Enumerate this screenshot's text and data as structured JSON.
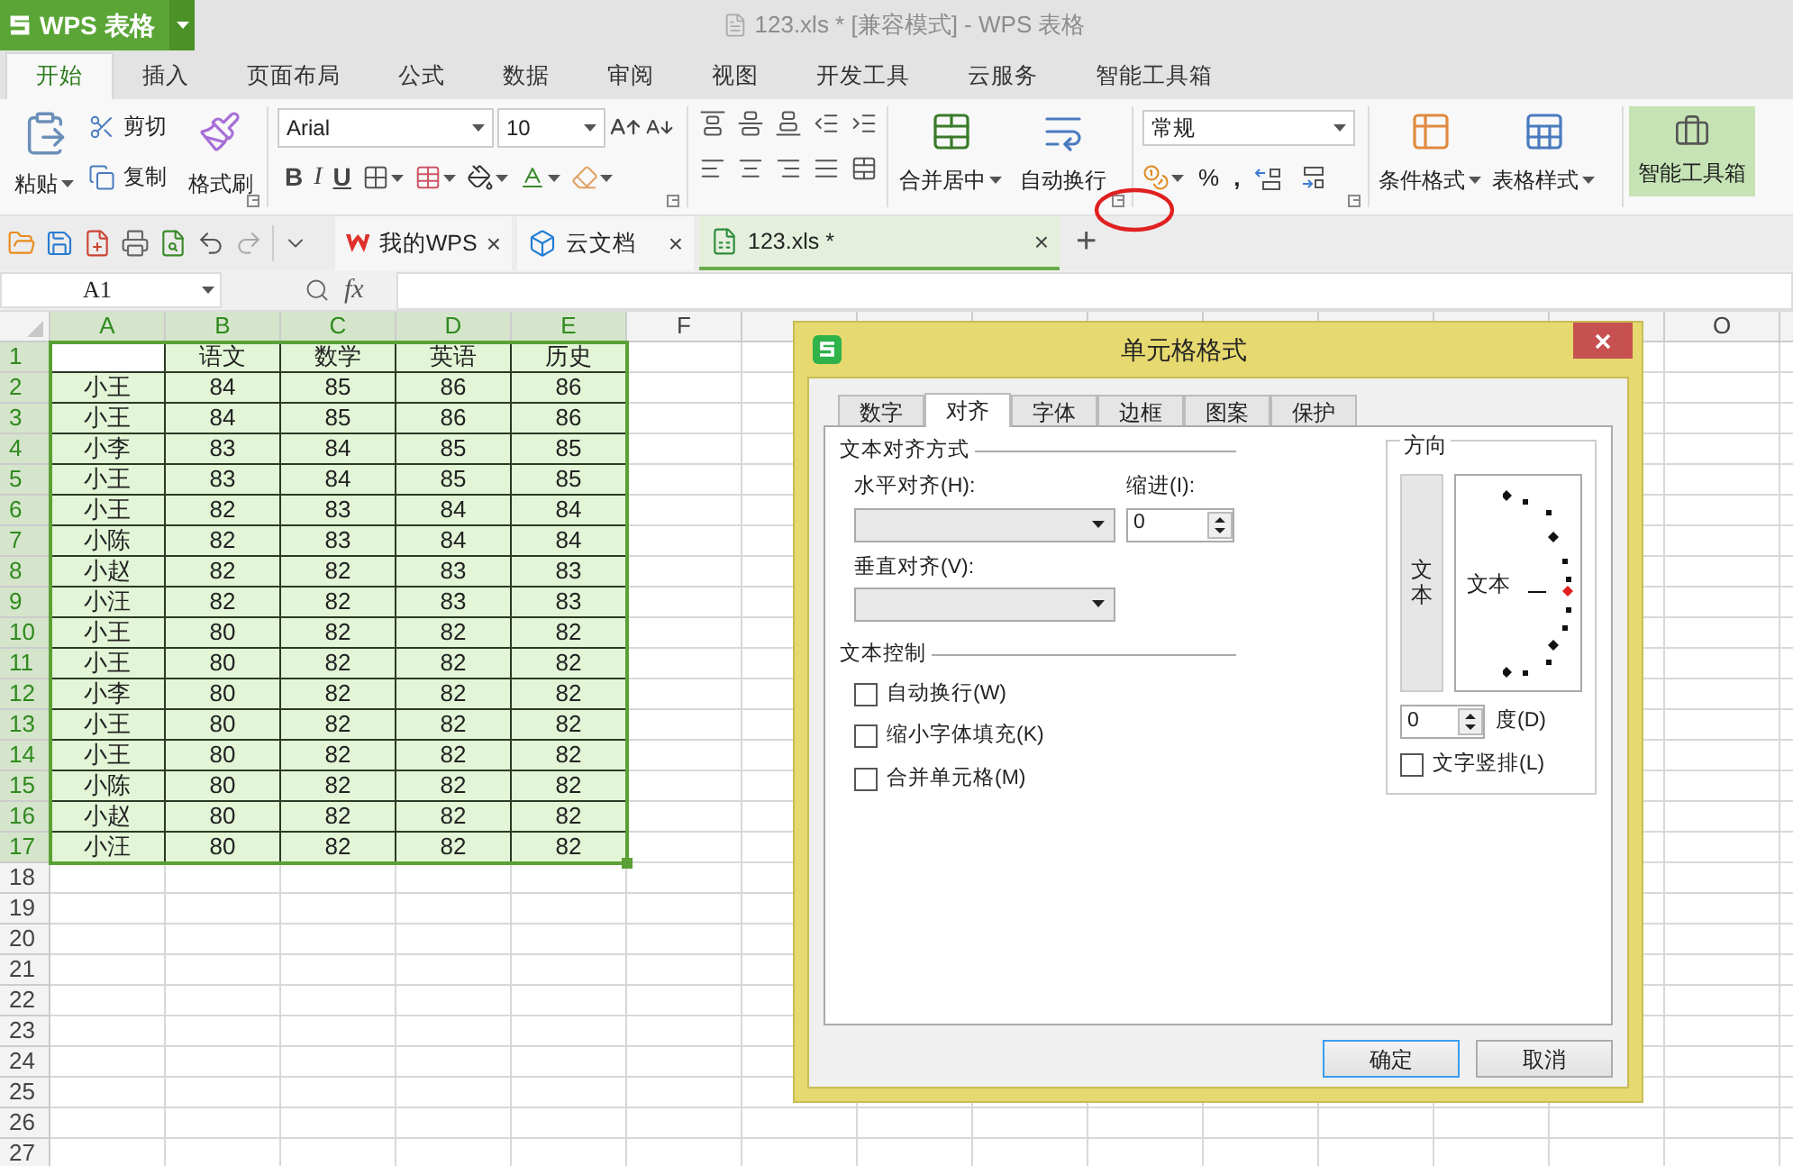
{
  "app": {
    "menu_button": "WPS 表格",
    "title": "123.xls * [兼容模式] - WPS 表格"
  },
  "menu_tabs": [
    {
      "label": "开始",
      "selected": true
    },
    {
      "label": "插入",
      "selected": false
    },
    {
      "label": "页面布局",
      "selected": false
    },
    {
      "label": "公式",
      "selected": false
    },
    {
      "label": "数据",
      "selected": false
    },
    {
      "label": "审阅",
      "selected": false
    },
    {
      "label": "视图",
      "selected": false
    },
    {
      "label": "开发工具",
      "selected": false
    },
    {
      "label": "云服务",
      "selected": false
    },
    {
      "label": "智能工具箱",
      "selected": false
    }
  ],
  "ribbon": {
    "paste": "粘贴",
    "cut": "剪切",
    "copy": "复制",
    "format_painter": "格式刷",
    "font_name": "Arial",
    "font_size": "10",
    "bold": "B",
    "italic": "I",
    "underline": "U",
    "merge": "合并居中",
    "wrap": "自动换行",
    "number_format": "常规",
    "percent": "%",
    "comma": ",",
    "conditional_format": "条件格式",
    "table_style": "表格样式",
    "toolbox": "智能工具箱"
  },
  "doc_tabs": [
    {
      "label": "我的WPS",
      "close": "×",
      "selected": false,
      "kind": "home"
    },
    {
      "label": "云文档",
      "close": "×",
      "selected": false,
      "kind": "cloud"
    },
    {
      "label": "123.xls *",
      "close": "×",
      "selected": true,
      "kind": "sheet"
    }
  ],
  "new_tab": "+",
  "formula_bar": {
    "cell_name": "A1",
    "fx": "fx"
  },
  "sheet": {
    "columns": [
      {
        "label": "A",
        "selected": true
      },
      {
        "label": "B",
        "selected": true
      },
      {
        "label": "C",
        "selected": true
      },
      {
        "label": "D",
        "selected": true
      },
      {
        "label": "E",
        "selected": true
      },
      {
        "label": "F",
        "selected": false
      },
      {
        "label": "O",
        "selected": false
      }
    ],
    "rows": [
      {
        "number": "1",
        "selected": true,
        "cells": [
          null,
          "语文",
          "数学",
          "英语",
          "历史"
        ]
      },
      {
        "number": "2",
        "selected": true,
        "cells": [
          "小王",
          "84",
          "85",
          "86",
          "86"
        ]
      },
      {
        "number": "3",
        "selected": true,
        "cells": [
          "小王",
          "84",
          "85",
          "86",
          "86"
        ]
      },
      {
        "number": "4",
        "selected": true,
        "cells": [
          "小李",
          "83",
          "84",
          "85",
          "85"
        ]
      },
      {
        "number": "5",
        "selected": true,
        "cells": [
          "小王",
          "83",
          "84",
          "85",
          "85"
        ]
      },
      {
        "number": "6",
        "selected": true,
        "cells": [
          "小王",
          "82",
          "83",
          "84",
          "84"
        ]
      },
      {
        "number": "7",
        "selected": true,
        "cells": [
          "小陈",
          "82",
          "83",
          "84",
          "84"
        ]
      },
      {
        "number": "8",
        "selected": true,
        "cells": [
          "小赵",
          "82",
          "82",
          "83",
          "83"
        ]
      },
      {
        "number": "9",
        "selected": true,
        "cells": [
          "小汪",
          "82",
          "82",
          "83",
          "83"
        ]
      },
      {
        "number": "10",
        "selected": true,
        "cells": [
          "小王",
          "80",
          "82",
          "82",
          "82"
        ]
      },
      {
        "number": "11",
        "selected": true,
        "cells": [
          "小王",
          "80",
          "82",
          "82",
          "82"
        ]
      },
      {
        "number": "12",
        "selected": true,
        "cells": [
          "小李",
          "80",
          "82",
          "82",
          "82"
        ]
      },
      {
        "number": "13",
        "selected": true,
        "cells": [
          "小王",
          "80",
          "82",
          "82",
          "82"
        ]
      },
      {
        "number": "14",
        "selected": true,
        "cells": [
          "小王",
          "80",
          "82",
          "82",
          "82"
        ]
      },
      {
        "number": "15",
        "selected": true,
        "cells": [
          "小陈",
          "80",
          "82",
          "82",
          "82"
        ]
      },
      {
        "number": "16",
        "selected": true,
        "cells": [
          "小赵",
          "80",
          "82",
          "82",
          "82"
        ]
      },
      {
        "number": "17",
        "selected": true,
        "cells": [
          "小汪",
          "80",
          "82",
          "82",
          "82"
        ]
      },
      {
        "number": "18",
        "selected": false
      },
      {
        "number": "19",
        "selected": false
      },
      {
        "number": "20",
        "selected": false
      },
      {
        "number": "21",
        "selected": false
      },
      {
        "number": "22",
        "selected": false
      },
      {
        "number": "23",
        "selected": false
      },
      {
        "number": "24",
        "selected": false
      },
      {
        "number": "25",
        "selected": false
      },
      {
        "number": "26",
        "selected": false
      },
      {
        "number": "27",
        "selected": false
      }
    ]
  },
  "dialog": {
    "title": "单元格格式",
    "tabs": [
      {
        "label": "数字",
        "selected": false
      },
      {
        "label": "对齐",
        "selected": true
      },
      {
        "label": "字体",
        "selected": false
      },
      {
        "label": "边框",
        "selected": false
      },
      {
        "label": "图案",
        "selected": false
      },
      {
        "label": "保护",
        "selected": false
      }
    ],
    "align_group": "文本对齐方式",
    "horizontal_label": "水平对齐(H):",
    "indent_label": "缩进(I):",
    "indent_value": "0",
    "vertical_label": "垂直对齐(V):",
    "control_group": "文本控制",
    "checkboxes": [
      {
        "label": "自动换行(W)",
        "checked": false
      },
      {
        "label": "缩小字体填充(K)",
        "checked": false
      },
      {
        "label": "合并单元格(M)",
        "checked": false
      }
    ],
    "orientation_group": "方向",
    "vertical_text": "文本",
    "dial_text": "文本",
    "degree_value": "0",
    "degree_label": "度(D)",
    "vertical_checkbox": {
      "label": "文字竖排(L)",
      "checked": false
    },
    "buttons": [
      {
        "label": "确定",
        "kind": "default"
      },
      {
        "label": "取消",
        "kind": "normal"
      }
    ]
  }
}
